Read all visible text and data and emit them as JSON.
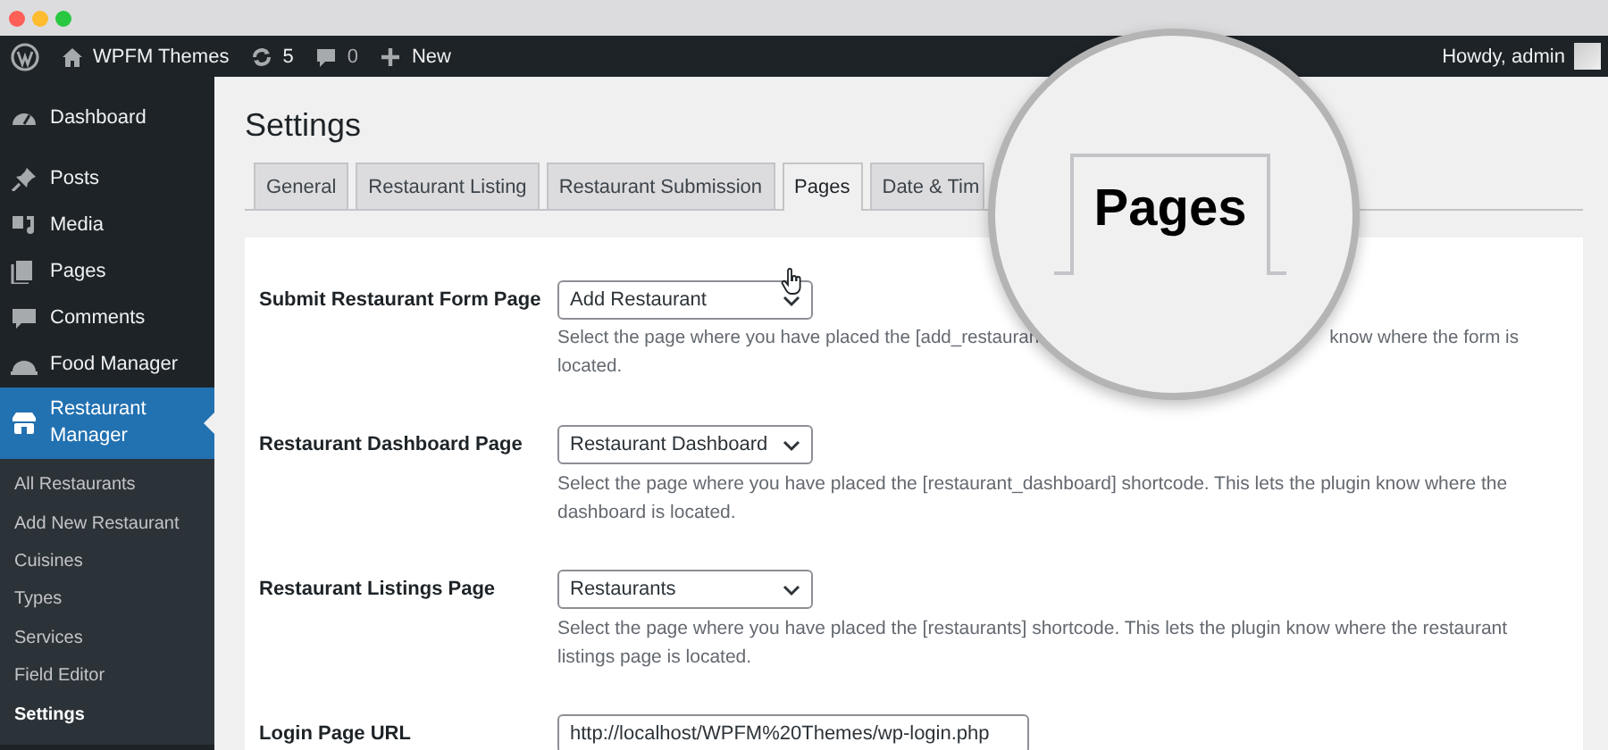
{
  "admin_bar": {
    "site_name": "WPFM Themes",
    "updates": "5",
    "comments": "0",
    "new": "New",
    "greeting": "Howdy, admin"
  },
  "sidebar": {
    "items": [
      {
        "label": "Dashboard",
        "selected": false
      },
      {
        "label": "Posts",
        "selected": false
      },
      {
        "label": "Media",
        "selected": false
      },
      {
        "label": "Pages",
        "selected": false
      },
      {
        "label": "Comments",
        "selected": false
      },
      {
        "label": "Food Manager",
        "selected": false
      },
      {
        "label": "Restaurant Manager",
        "selected": true,
        "children": [
          {
            "label": "All Restaurants",
            "selected": false
          },
          {
            "label": "Add New Restaurant",
            "selected": false
          },
          {
            "label": "Cuisines",
            "selected": false
          },
          {
            "label": "Types",
            "selected": false
          },
          {
            "label": "Services",
            "selected": false
          },
          {
            "label": "Field Editor",
            "selected": false
          },
          {
            "label": "Settings",
            "selected": true
          }
        ]
      }
    ]
  },
  "page_title": "Settings",
  "tabs": [
    {
      "label": "General",
      "selected": false
    },
    {
      "label": "Restaurant Listing",
      "selected": false
    },
    {
      "label": "Restaurant Submission",
      "selected": false
    },
    {
      "label": "Pages",
      "selected": true
    },
    {
      "label": "Date & Tim",
      "selected": false
    }
  ],
  "magnifier": {
    "label": "Pages"
  },
  "fields": [
    {
      "kind": "select",
      "label": "Submit Restaurant Form Page",
      "value": "Add Restaurant",
      "description": [
        "Select the page where you have placed the [add_restauran",
        "know where the form is",
        "located."
      ]
    },
    {
      "kind": "select",
      "label": "Restaurant Dashboard Page",
      "value": "Restaurant Dashboard",
      "description": "Select the page where you have placed the [restaurant_dashboard] shortcode. This lets the plugin know where the dashboard is located."
    },
    {
      "kind": "select",
      "label": "Restaurant Listings Page",
      "value": "Restaurants",
      "description": "Select the page where you have placed the [restaurants] shortcode. This lets the plugin know where the restaurant listings page is located."
    },
    {
      "kind": "input",
      "label": "Login Page URL",
      "value": "http://localhost/WPFM%20Themes/wp-login.php"
    }
  ]
}
